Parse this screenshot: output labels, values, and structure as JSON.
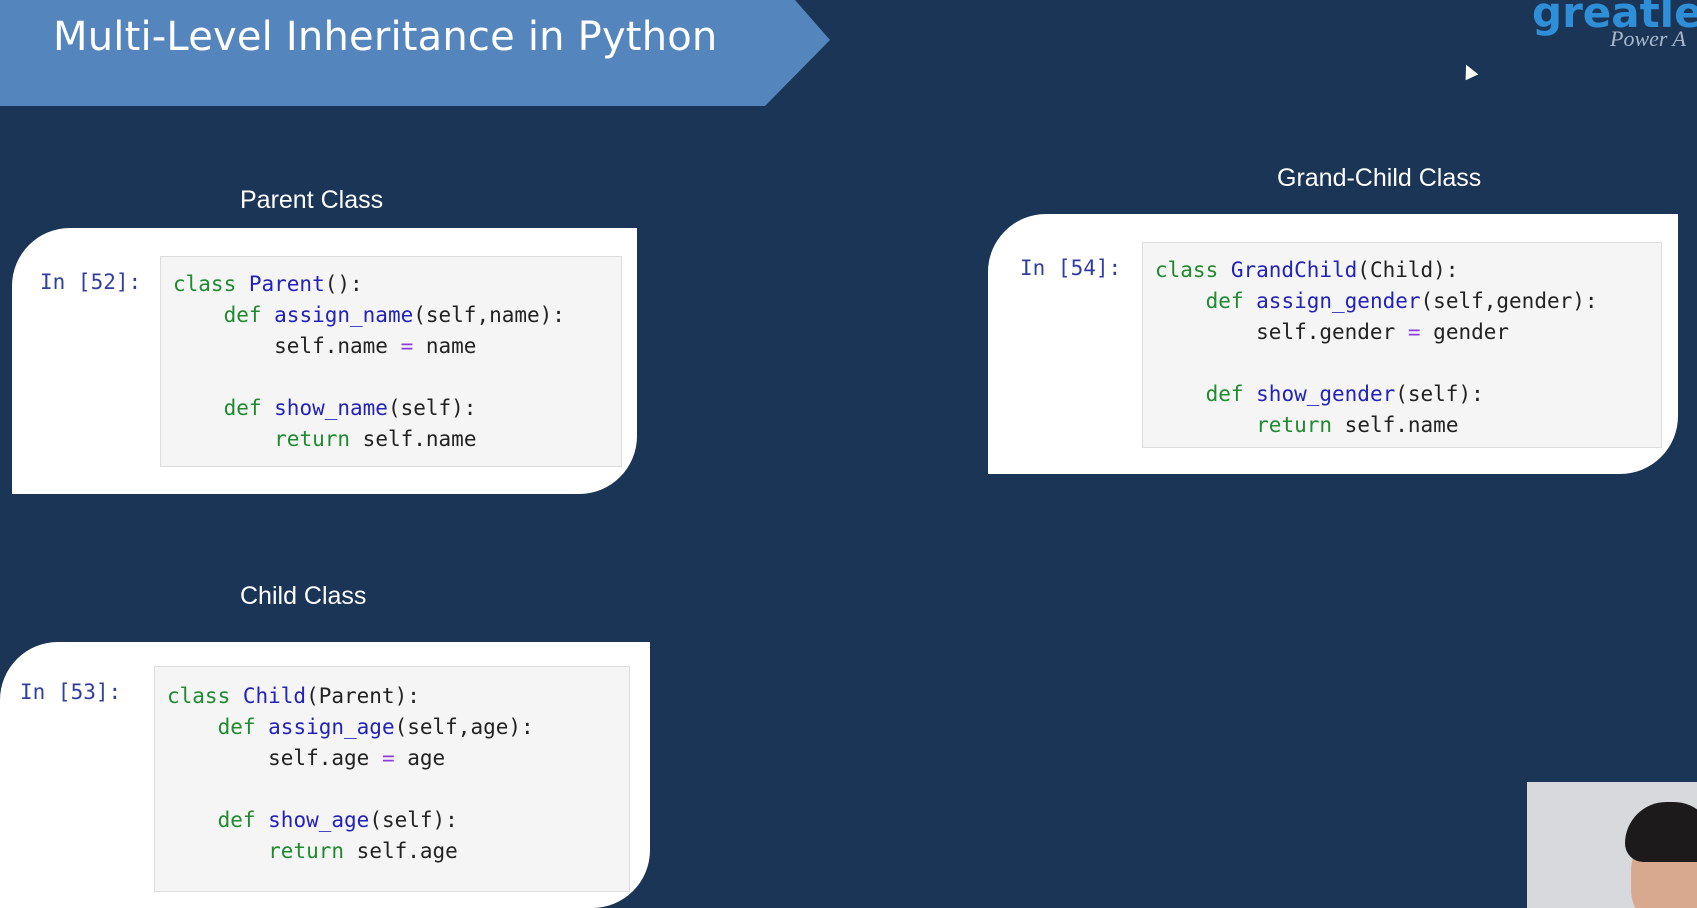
{
  "slide": {
    "title": "Multi-Level Inheritance in Python"
  },
  "logo": {
    "word": "greatle",
    "tagline": "Power A"
  },
  "cells": {
    "parent": {
      "label": "Parent Class",
      "prompt": "In [52]:",
      "lines": [
        [
          [
            "kw",
            "class "
          ],
          [
            "nm",
            "Parent"
          ],
          [
            "",
            "():"
          ]
        ],
        [
          [
            "",
            "    "
          ],
          [
            "kw",
            "def "
          ],
          [
            "nm",
            "assign_name"
          ],
          [
            "",
            "(self,name):"
          ]
        ],
        [
          [
            "",
            "        self.name "
          ],
          [
            "op",
            "="
          ],
          [
            "",
            " name"
          ]
        ],
        [
          [
            "",
            ""
          ]
        ],
        [
          [
            "",
            "    "
          ],
          [
            "kw",
            "def "
          ],
          [
            "nm",
            "show_name"
          ],
          [
            "",
            "(self):"
          ]
        ],
        [
          [
            "",
            "        "
          ],
          [
            "kw",
            "return "
          ],
          [
            "",
            "self.name"
          ]
        ]
      ]
    },
    "child": {
      "label": "Child Class",
      "prompt": "In [53]:",
      "lines": [
        [
          [
            "kw",
            "class "
          ],
          [
            "nm",
            "Child"
          ],
          [
            "",
            "(Parent):"
          ]
        ],
        [
          [
            "",
            "    "
          ],
          [
            "kw",
            "def "
          ],
          [
            "nm",
            "assign_age"
          ],
          [
            "",
            "(self,age):"
          ]
        ],
        [
          [
            "",
            "        self.age "
          ],
          [
            "op",
            "="
          ],
          [
            "",
            " age"
          ]
        ],
        [
          [
            "",
            ""
          ]
        ],
        [
          [
            "",
            "    "
          ],
          [
            "kw",
            "def "
          ],
          [
            "nm",
            "show_age"
          ],
          [
            "",
            "(self):"
          ]
        ],
        [
          [
            "",
            "        "
          ],
          [
            "kw",
            "return "
          ],
          [
            "",
            "self.age"
          ]
        ]
      ]
    },
    "grandchild": {
      "label": "Grand-Child Class",
      "prompt": "In [54]:",
      "lines": [
        [
          [
            "kw",
            "class "
          ],
          [
            "nm",
            "GrandChild"
          ],
          [
            "",
            "(Child):"
          ]
        ],
        [
          [
            "",
            "    "
          ],
          [
            "kw",
            "def "
          ],
          [
            "nm",
            "assign_gender"
          ],
          [
            "",
            "(self,gender):"
          ]
        ],
        [
          [
            "",
            "        self.gender "
          ],
          [
            "op",
            "="
          ],
          [
            "",
            " gender"
          ]
        ],
        [
          [
            "",
            ""
          ]
        ],
        [
          [
            "",
            "    "
          ],
          [
            "kw",
            "def "
          ],
          [
            "nm",
            "show_gender"
          ],
          [
            "",
            "(self):"
          ]
        ],
        [
          [
            "",
            "        "
          ],
          [
            "kw",
            "return "
          ],
          [
            "",
            "self.name"
          ]
        ]
      ]
    }
  },
  "colors": {
    "background": "#1b3556",
    "banner": "#5585bd",
    "keyword": "#1f8a2f",
    "name": "#2222bb",
    "operator": "#8a3ddb",
    "prompt": "#303f9f"
  }
}
